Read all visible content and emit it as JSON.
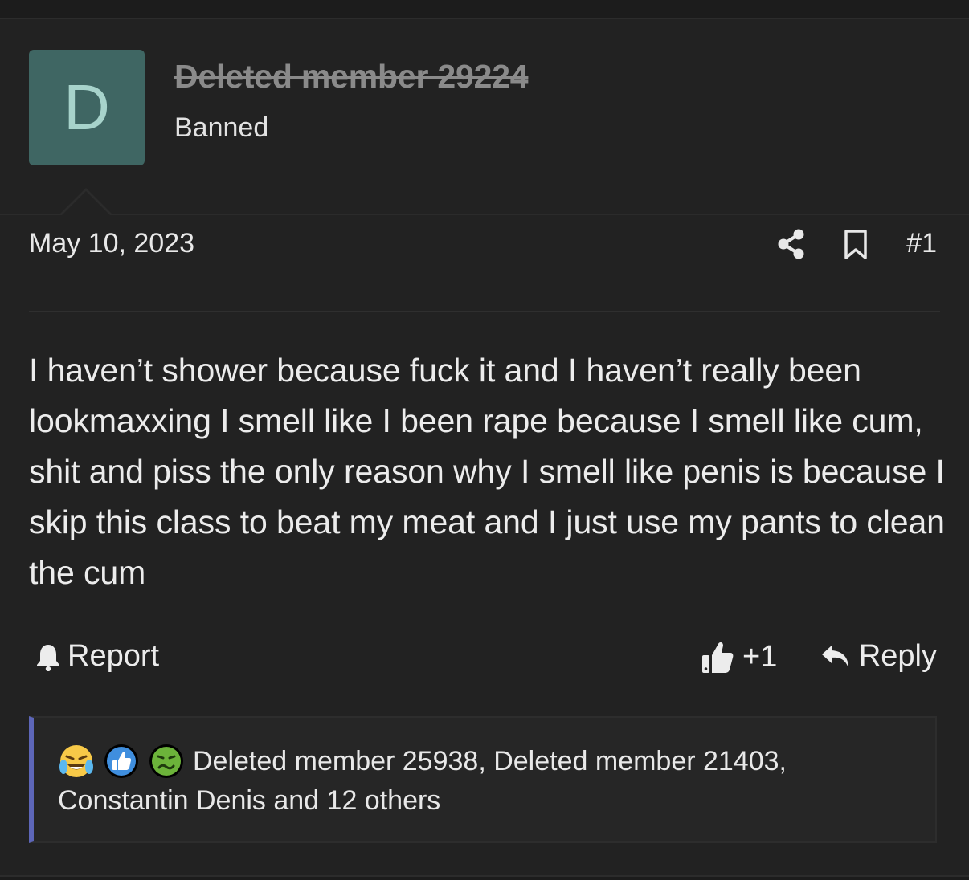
{
  "post": {
    "author": {
      "avatar_letter": "D",
      "username": "Deleted member 29224",
      "title": "Banned",
      "avatar_color": "#3f6663"
    },
    "date": "May 10, 2023",
    "number": "#1",
    "icons": [
      "share-icon",
      "bookmark-icon"
    ],
    "message": "I haven’t shower because fuck it and I haven’t really been lookmaxxing I smell like I been rape because I smell like cum, shit and piss the only reason why I smell like penis is because I skip this class to beat my meat and I just use my pants to clean the cum",
    "actions": {
      "report_label": "Report",
      "like_label": "+1",
      "reply_label": "Reply"
    },
    "reactions": {
      "emojis": [
        "crying-laughing-emoji",
        "thumbs-up-emoji",
        "nauseated-emoji"
      ],
      "summary": "Deleted member 25938, Deleted member 21403, Constantin Denis and 12 others"
    }
  },
  "colors": {
    "background": "#1c1c1c",
    "post_background": "#222222",
    "accent_bar": "#5d66b8",
    "username_struck": "#8a8a8a"
  }
}
